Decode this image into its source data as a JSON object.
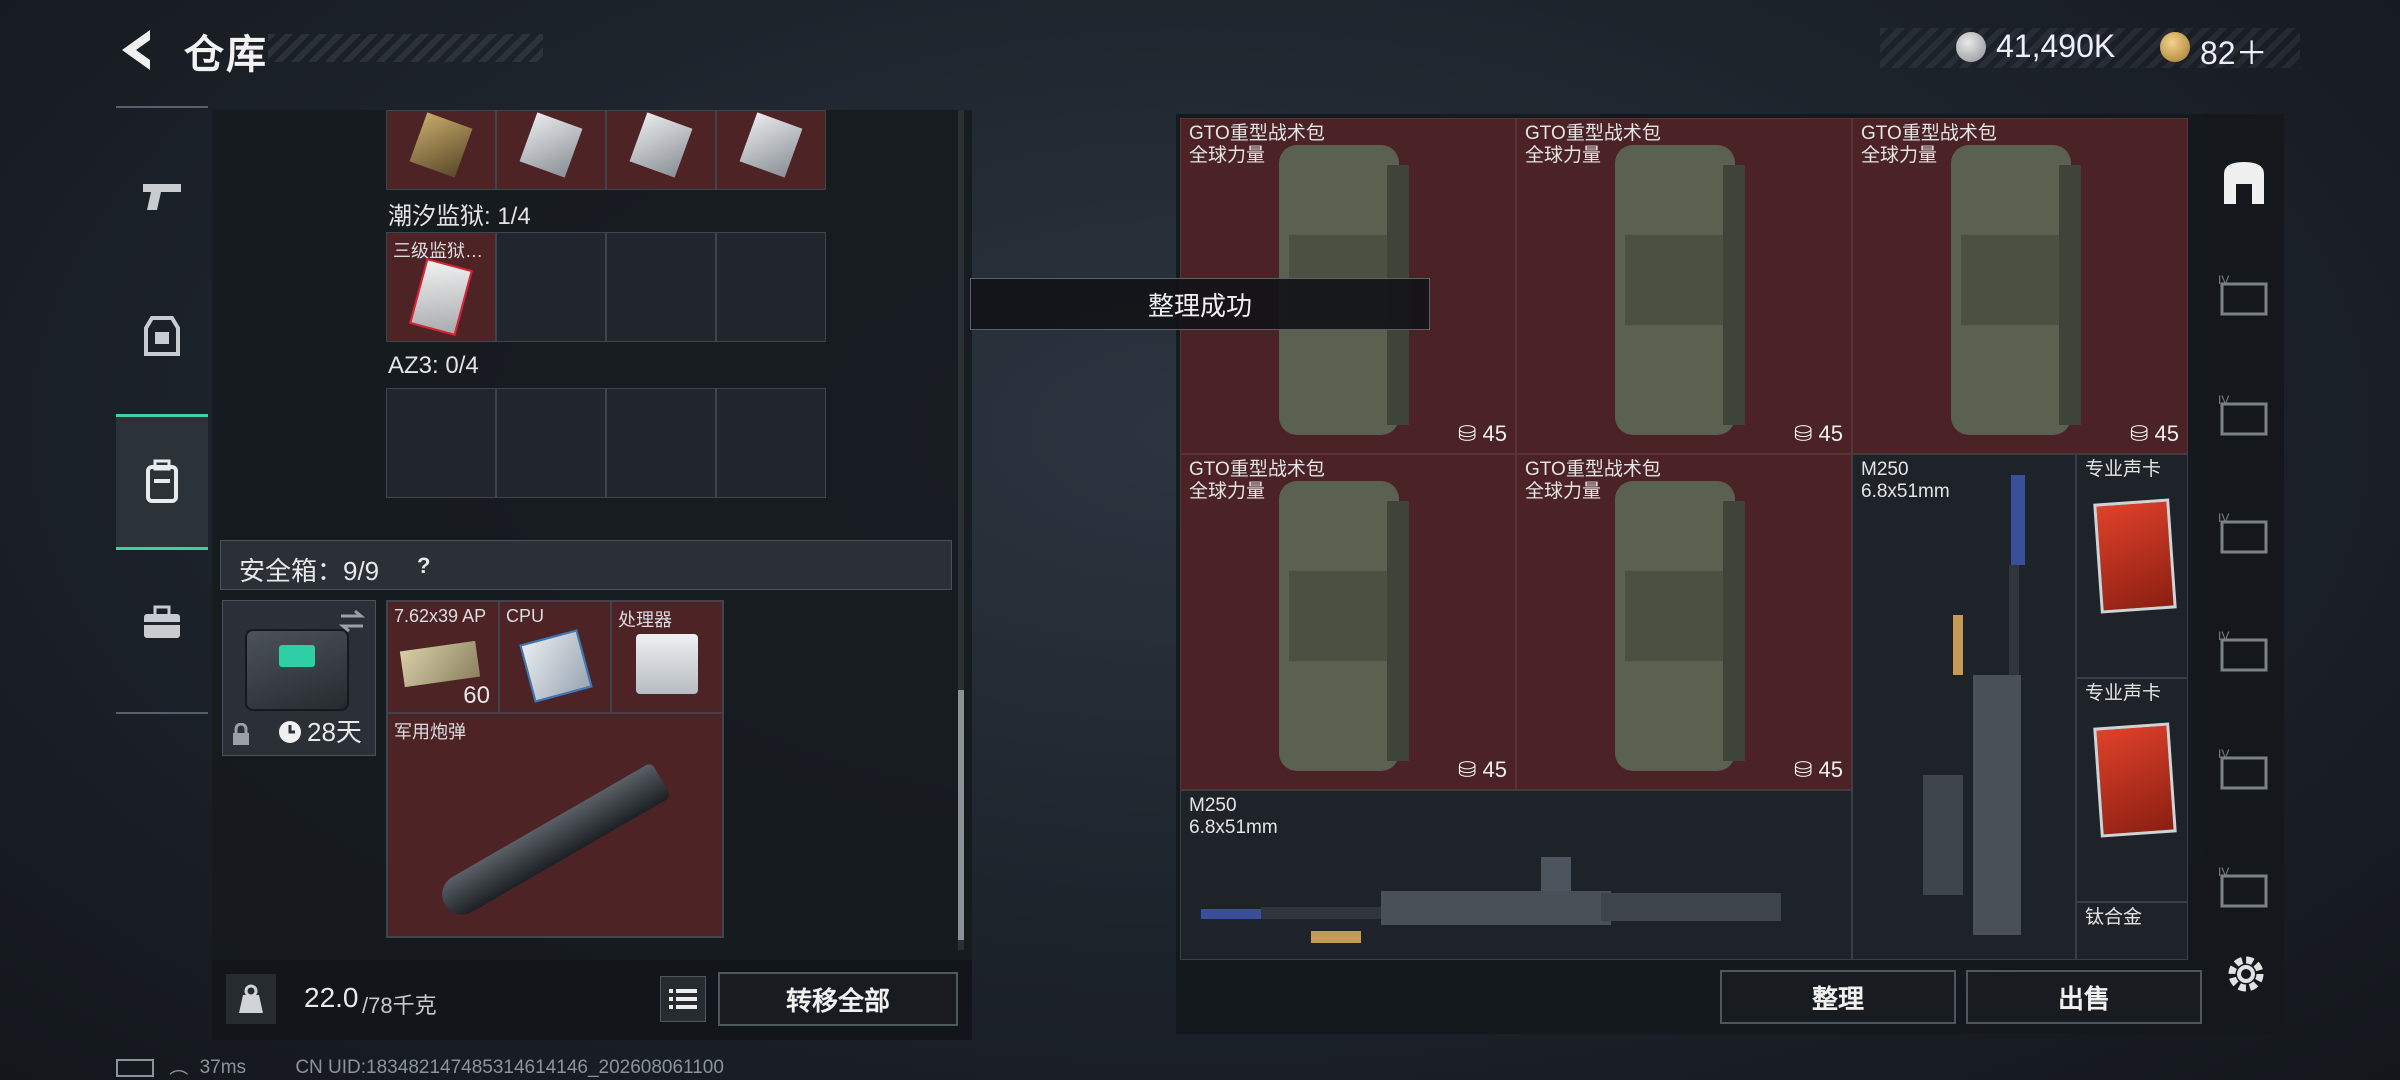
{
  "header": {
    "title": "仓库",
    "money": "41,490K",
    "coupon": "82＋"
  },
  "toast": "整理成功",
  "left": {
    "tide_prison_label": "潮汐监狱: 1/4",
    "tide_item_name": "三级监狱…",
    "az3_label": "AZ3: 0/4",
    "safebox": {
      "label": "安全箱：9/9",
      "help": "?",
      "days": "28天"
    },
    "safe_items": [
      {
        "name": "7.62x39 AP",
        "count": "60"
      },
      {
        "name": "CPU"
      },
      {
        "name": "处理器"
      },
      {
        "name": "军用炮弹"
      }
    ],
    "weight": {
      "current": "22.0",
      "max": "/78千克"
    },
    "transfer_all": "转移全部"
  },
  "right": {
    "bags": [
      {
        "name": "GTO重型战术包",
        "brand": "全球力量",
        "weight": "45"
      },
      {
        "name": "GTO重型战术包",
        "brand": "全球力量",
        "weight": "45"
      },
      {
        "name": "GTO重型战术包",
        "brand": "全球力量",
        "weight": "45"
      },
      {
        "name": "GTO重型战术包",
        "brand": "全球力量",
        "weight": "45"
      },
      {
        "name": "GTO重型战术包",
        "brand": "全球力量",
        "weight": "45"
      }
    ],
    "m250_vertical": {
      "name": "M250",
      "caliber": "6.8x51mm"
    },
    "m250_horizontal": {
      "name": "M250",
      "caliber": "6.8x51mm"
    },
    "sound_cards": [
      {
        "name": "专业声卡"
      },
      {
        "name": "专业声卡"
      }
    ],
    "titanium": "钛合金",
    "sort_button": "整理",
    "sell_button": "出售"
  },
  "status": {
    "ping": "37ms",
    "uid": "CN UID:18348214748531461414​6_202608061100"
  },
  "colors": {
    "accent_green": "#3fd0a0",
    "item_red": "#4b2225",
    "panel_dark": "#1a1f24"
  }
}
